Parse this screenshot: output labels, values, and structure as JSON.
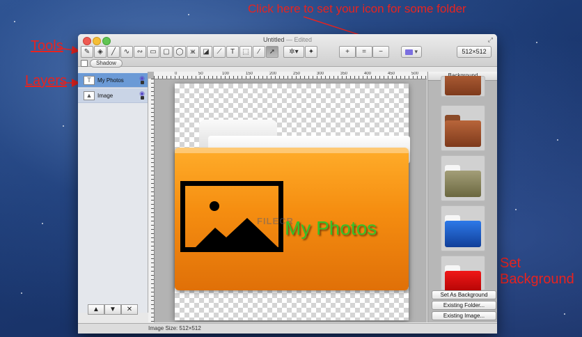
{
  "annotations": {
    "top": "Click here to set your icon for some folder",
    "tools": "Tools",
    "layers": "Layers",
    "set_background_line1": "Set",
    "set_background_line2": "Background",
    "color": "#e8231f"
  },
  "window": {
    "title": "Untitled",
    "title_suffix": "— Edited"
  },
  "toolbar": {
    "tools": [
      "pencil-icon",
      "paint-bucket-icon",
      "line-icon",
      "zigzag-icon",
      "curve-icon",
      "rectangle-icon",
      "rounded-rect-icon",
      "ellipse-icon",
      "butterfly-icon",
      "eraser-icon",
      "brush-icon",
      "text-icon",
      "selection-icon",
      "eyedropper-icon",
      "arrow-pointer-icon"
    ],
    "zoom_buttons": [
      "+",
      "=",
      "−"
    ],
    "size_select": "512×512"
  },
  "shadow": {
    "label": "Shadow"
  },
  "layers": {
    "items": [
      {
        "name": "My Photos",
        "thumb": "T",
        "selected": true
      },
      {
        "name": "Image",
        "thumb": "▲",
        "selected": false
      }
    ],
    "controls": [
      "^",
      "v",
      "×"
    ]
  },
  "ruler": {
    "labels": [
      "0",
      "50",
      "100",
      "150",
      "200",
      "250",
      "300",
      "350",
      "400",
      "450",
      "500"
    ]
  },
  "canvas": {
    "overlay_text": "My Photos",
    "watermark": "FILECR"
  },
  "background_panel": {
    "title": "Background",
    "buttons": {
      "set": "Set As Background",
      "folder": "Existing Folder...",
      "image": "Existing Image..."
    }
  },
  "status": {
    "image_size": "Image Size: 512×512"
  }
}
